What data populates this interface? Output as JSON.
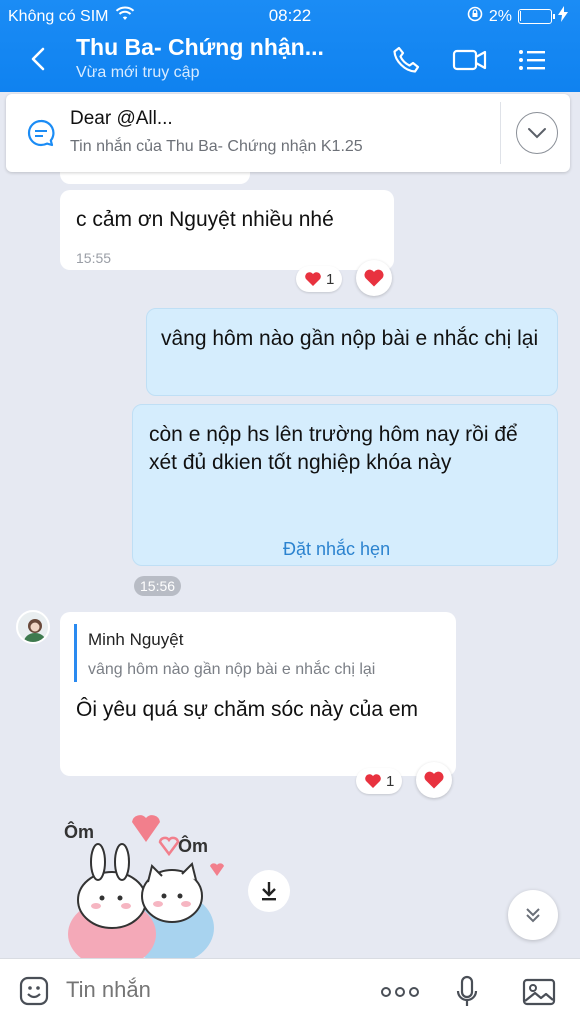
{
  "status_bar": {
    "carrier": "Không có SIM",
    "time": "08:22",
    "battery": "2%",
    "battery_level": 0.02
  },
  "header": {
    "title": "Thu Ba- Chứng nhận...",
    "subtitle": "Vừa mới truy cập"
  },
  "pinned": {
    "title": "Dear @All...",
    "subtitle": "Tin nhắn của Thu Ba- Chứng nhận K1.25"
  },
  "messages": [
    {
      "text": "c cảm ơn Nguyệt nhiều nhé",
      "time": "15:55",
      "reaction_count": "1"
    },
    {
      "text": "vâng hôm nào gần nộp bài e nhắc chị lại"
    },
    {
      "text": "còn e nộp hs lên trường hôm nay rồi để xét đủ dkien tốt nghiệp khóa này",
      "action": "Đặt nhắc hẹn",
      "time": "15:56"
    },
    {
      "quote_name": "Minh Nguyệt",
      "quote_text": "vâng hôm nào gần nộp bài e nhắc chị lại",
      "text": "Ôi yêu quá sự chăm sóc này của em",
      "reaction_count": "1"
    }
  ],
  "sticker": {
    "text_left": "Ôm",
    "text_right": "Ôm"
  },
  "composer": {
    "placeholder": "Tin nhắn"
  },
  "colors": {
    "header": "#1b8cf5",
    "out_bubble": "#d5edfd",
    "heart": "#e8323f"
  }
}
